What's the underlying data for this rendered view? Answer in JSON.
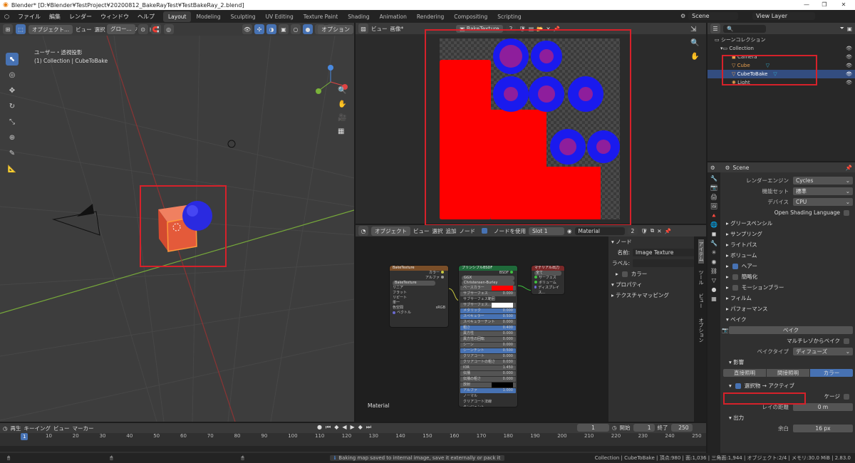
{
  "window": {
    "title": "Blender* [D:¥Blender¥TestProject¥20200812_BakeRayTest¥TestBakeRay_2.blend]",
    "min": "—",
    "max": "❐",
    "close": "✕"
  },
  "menubar": {
    "items": [
      "ファイル",
      "編集",
      "レンダー",
      "ウィンドウ",
      "ヘルプ"
    ]
  },
  "workspaces": [
    "Layout",
    "Modeling",
    "Sculpting",
    "UV Editing",
    "Texture Paint",
    "Shading",
    "Animation",
    "Rendering",
    "Compositing",
    "Scripting"
  ],
  "scene": {
    "name": "Scene",
    "viewlayer": "View Layer"
  },
  "viewport": {
    "mode": "オブジェクト...",
    "menus": [
      "ビュー",
      "選択",
      "追加",
      "オブジェクト"
    ],
    "orient": "グロー...",
    "options": "オプション",
    "info1": "ユーザー・透視投影",
    "info2": "(1) Collection | CubeToBake"
  },
  "image_editor": {
    "menus": [
      "ビュー",
      "画像*"
    ],
    "image": "BakeTexture",
    "users": "2"
  },
  "node_editor": {
    "mode": "オブジェクト",
    "menus": [
      "ビュー",
      "選択",
      "追加",
      "ノード"
    ],
    "use_nodes": "ノードを使用",
    "slot": "Slot 1",
    "material": "Material",
    "users": "2",
    "label": "Material",
    "side": {
      "tab": "ノード",
      "name_label": "名前:",
      "name_value": "Image Texture",
      "label_label": "ラベル:",
      "color": "カラー",
      "props": "プロパティ",
      "texmap": "テクスチャマッピング"
    },
    "vtabs": [
      "アイテム",
      "ツール",
      "ビュー",
      "オプション"
    ],
    "img_node": {
      "title": "BakeTexture",
      "out1": "カラー",
      "out2": "アルファ",
      "img": "BakeTexture",
      "opts": [
        "リニア",
        "フラット",
        "リピート",
        "単一",
        "ベクトル"
      ],
      "cs": "sRGB",
      "cs_label": "色空間"
    },
    "bsdf": {
      "title": "プリンシプルBSDF",
      "out": "BSDF",
      "dist": "GGX",
      "sss": "Christensen-Burley",
      "rows": [
        [
          "ベースカラー",
          ""
        ],
        [
          "サブサーフェス",
          "0.000"
        ],
        [
          "サブサーフェス範囲",
          ""
        ],
        [
          "サブサーフェス...",
          ""
        ],
        [
          "メタリック",
          "0.000"
        ],
        [
          "スペキュラー",
          "0.500"
        ],
        [
          "スペキュラーチント",
          "0.000"
        ],
        [
          "粗さ",
          "0.400"
        ],
        [
          "異方性",
          "0.000"
        ],
        [
          "異方性の回転",
          "0.000"
        ],
        [
          "シーン",
          "0.000"
        ],
        [
          "シーンチント",
          "0.500"
        ],
        [
          "クリアコート",
          "0.000"
        ],
        [
          "クリアコートの粗さ",
          "0.030"
        ],
        [
          "IOR",
          "1.450"
        ],
        [
          "伝播",
          "0.000"
        ],
        [
          "伝播の粗さ",
          "0.000"
        ],
        [
          "放射",
          ""
        ],
        [
          "アルファ",
          "1.000"
        ],
        [
          "ノーマル",
          ""
        ],
        [
          "クリアコート法線",
          ""
        ],
        [
          "タンジェント",
          ""
        ]
      ]
    },
    "matout": {
      "title": "マテリアル出力",
      "target": "全て",
      "ins": [
        "サーフェス",
        "ボリューム",
        "ディスプレイス..."
      ]
    }
  },
  "outliner": {
    "root": "シーンコレクション",
    "items": [
      {
        "name": "Collection"
      },
      {
        "name": "Camera"
      },
      {
        "name": "Cube"
      },
      {
        "name": "CubeToBake"
      },
      {
        "name": "Light"
      }
    ]
  },
  "properties": {
    "scene": "Scene",
    "rows": [
      {
        "label": "レンダーエンジン",
        "value": "Cycles"
      },
      {
        "label": "機能セット",
        "value": "標準"
      },
      {
        "label": "デバイス",
        "value": "CPU"
      }
    ],
    "osl": "Open Shading Language",
    "sections": [
      "グリースペンシル",
      "サンプリング",
      "ライトパス",
      "ボリューム",
      "ヘアー",
      "簡略化",
      "モーションブラー",
      "フィルム",
      "パフォーマンス",
      "ベイク"
    ],
    "bake_button": "ベイク",
    "multires": "マルチレゾからベイク",
    "bake_type_label": "ベイクタイプ",
    "bake_type": "ディフューズ",
    "influence": "影響",
    "influence_tabs": [
      "直接照明",
      "間接照明",
      "カラー"
    ],
    "sel_to_active": "選択物 → アクティブ",
    "cage": "ケージ",
    "ray_label": "レイの距離",
    "ray": "0 m",
    "output": "出力",
    "margin_label": "余白",
    "margin": "16 px"
  },
  "timeline": {
    "menus": [
      "再生",
      "キーイング",
      "ビュー",
      "マーカー"
    ],
    "frame": "1",
    "start_label": "開始",
    "start": "1",
    "end_label": "終了",
    "end": "250",
    "current": "1",
    "ticks": [
      "10",
      "20",
      "30",
      "40",
      "50",
      "60",
      "70",
      "80",
      "90",
      "100",
      "110",
      "120",
      "130",
      "140",
      "150",
      "160",
      "170",
      "180",
      "190",
      "200",
      "210",
      "220",
      "230",
      "240",
      "250"
    ]
  },
  "status": {
    "message": "Baking map saved to internal image, save it externally or pack it",
    "info": "Collection | CubeToBake | 頂点:980 | 面:1,036 | 三角面:1,944 | オブジェクト:2/4 | メモリ:30.0 MiB | 2.83.0"
  }
}
